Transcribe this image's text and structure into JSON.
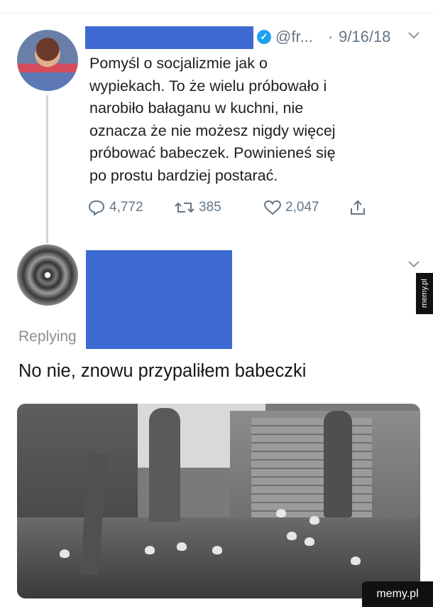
{
  "tweet1": {
    "handle": "@fr...",
    "date": "9/16/18",
    "text": "Pomyśl o socjalizmie jak o\nwypiekach. To że wielu próbowało i\nnarobiło bałaganu w kuchni, nie\noznacza że nie możesz nigdy więcej\npróbować babeczek. Powinieneś się\npo prostu bardziej postarać.",
    "reply_count": "4,772",
    "retweet_count": "385",
    "like_count": "2,047"
  },
  "tweet2": {
    "replying_label": "Replying",
    "text": "No nie, znowu przypaliłem babeczki"
  },
  "watermark": {
    "side": "memy.pl",
    "bottom": "memy.pl"
  },
  "colors": {
    "redaction": "#3e6bd3",
    "verified": "#1da1f2",
    "muted": "#657786"
  }
}
